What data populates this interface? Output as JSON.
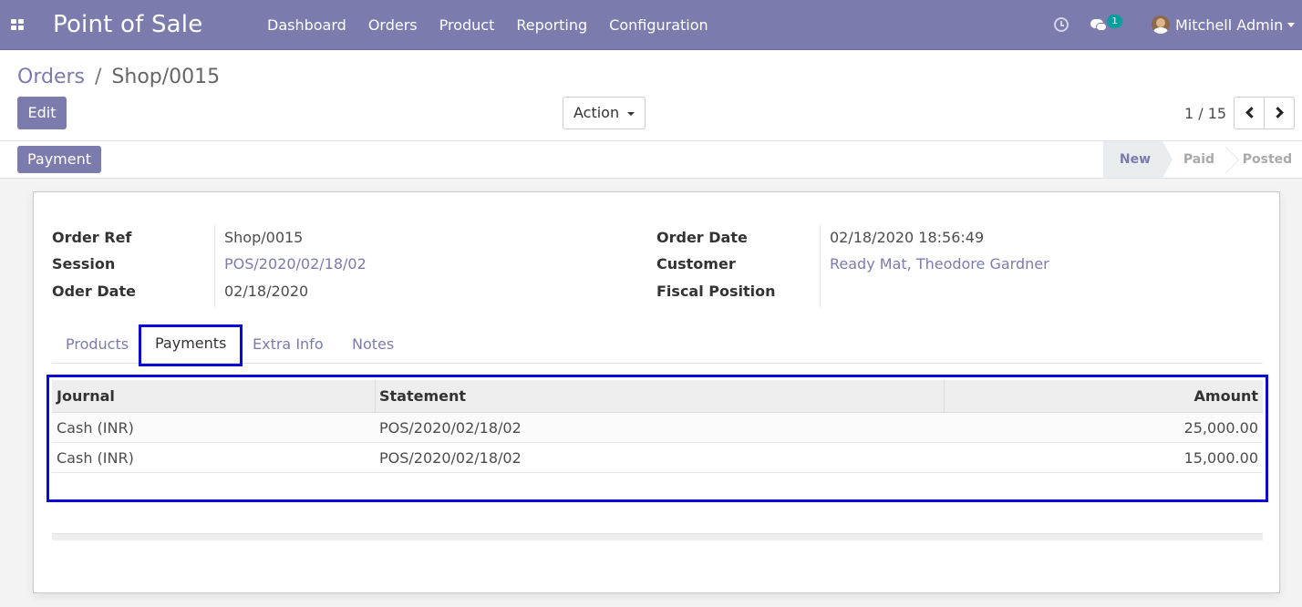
{
  "navbar": {
    "app_title": "Point of Sale",
    "menu": [
      "Dashboard",
      "Orders",
      "Product",
      "Reporting",
      "Configuration"
    ],
    "chat_badge": "1",
    "user_name": "Mitchell Admin",
    "bg_color": "#7c7bad"
  },
  "control_panel": {
    "breadcrumb_parent": "Orders",
    "breadcrumb_separator": "/",
    "breadcrumb_current": "Shop/0015",
    "edit_label": "Edit",
    "action_label": "Action",
    "pager_value": "1 / 15"
  },
  "statusbar": {
    "payment_label": "Payment",
    "stages": [
      "New",
      "Paid",
      "Posted"
    ],
    "active_stage": "New"
  },
  "form": {
    "order_ref_label": "Order Ref",
    "order_ref_value": "Shop/0015",
    "session_label": "Session",
    "session_value": "POS/2020/02/18/02",
    "oder_date_label": "Oder Date",
    "oder_date_value": "02/18/2020",
    "order_date_label": "Order Date",
    "order_date_value": "02/18/2020 18:56:49",
    "customer_label": "Customer",
    "customer_value": "Ready Mat, Theodore Gardner",
    "fiscal_position_label": "Fiscal Position",
    "fiscal_position_value": ""
  },
  "tabs": [
    "Products",
    "Payments",
    "Extra Info",
    "Notes"
  ],
  "active_tab": "Payments",
  "payments_table": {
    "headers": [
      "Journal",
      "Statement",
      "Amount"
    ],
    "rows": [
      {
        "journal": "Cash (INR)",
        "statement": "POS/2020/02/18/02",
        "amount": "25,000.00"
      },
      {
        "journal": "Cash (INR)",
        "statement": "POS/2020/02/18/02",
        "amount": "15,000.00"
      }
    ]
  },
  "colors": {
    "accent": "#7c7bad",
    "highlight_border": "#0a0ad6",
    "badge": "#00a09d"
  }
}
